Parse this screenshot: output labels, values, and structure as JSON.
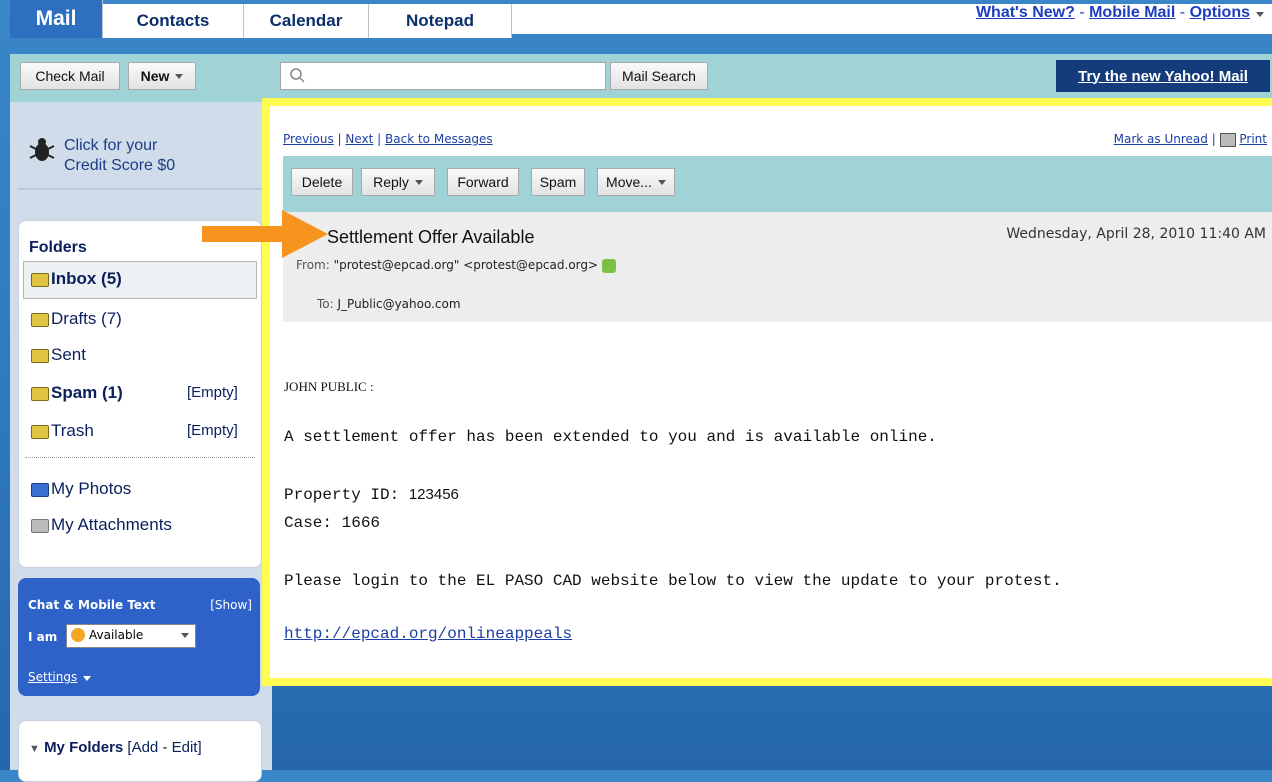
{
  "tabs": [
    "Mail",
    "Contacts",
    "Calendar",
    "Notepad"
  ],
  "top_links": {
    "whats_new": "What's New?",
    "sep1": "-",
    "mobile": "Mobile Mail",
    "sep2": "-",
    "options": "Options"
  },
  "toolbar": {
    "check_mail": "Check Mail",
    "new": "New",
    "search_button": "Mail Search",
    "try_new": "Try the new Yahoo! Mail"
  },
  "sidebar": {
    "credit": "Click for your Credit Score $0",
    "folders_title": "Folders",
    "folders": [
      {
        "label": "Inbox (5)",
        "empty": ""
      },
      {
        "label": "Drafts (7)",
        "empty": ""
      },
      {
        "label": "Sent",
        "empty": ""
      },
      {
        "label": "Spam (1)",
        "empty": "[Empty]"
      },
      {
        "label": "Trash",
        "empty": "[Empty]"
      }
    ],
    "my_photos": "My Photos",
    "my_attachments": "My Attachments",
    "chat": {
      "title": "Chat & Mobile Text",
      "show": "[Show]",
      "iam": "I am",
      "status": "Available",
      "settings": "Settings"
    },
    "my_folders": {
      "label": "My Folders",
      "add_edit": "[Add - Edit]"
    }
  },
  "message": {
    "nav": {
      "previous": "Previous",
      "next": "Next",
      "back": "Back to Messages",
      "mark_unread": "Mark as Unread",
      "print": "Print"
    },
    "actions": [
      "Delete",
      "Reply",
      "Forward",
      "Spam",
      "Move..."
    ],
    "subject": "Settlement Offer Available",
    "date": "Wednesday, April 28, 2010 11:40 AM",
    "from_label": "From:",
    "from": "\"protest@epcad.org\" <protest@epcad.org>",
    "to_label": "To:",
    "to": "J_Public@yahoo.com",
    "greeting": "JOHN PUBLIC :",
    "line1": "A settlement offer has been extended to you and is available online.",
    "property_label": "Property ID:",
    "property_id": "123456",
    "case": "Case: 1666",
    "line2": "Please login to the EL PASO CAD website below to view the update to your protest.",
    "link": "http://epcad.org/onlineappeals"
  },
  "colors": {
    "highlight_frame": "#fefc50",
    "arrow": "#f7941d",
    "toolbar_teal": "#9fd3d6"
  }
}
